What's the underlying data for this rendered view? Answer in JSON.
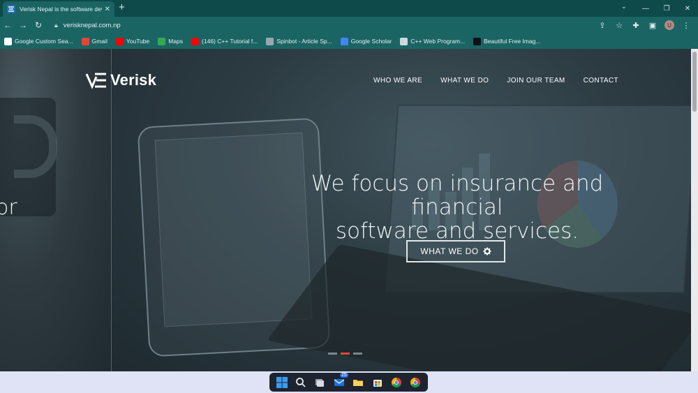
{
  "browser": {
    "tab_title": "Verisk Nepal is the software deve",
    "url": "verisknepal.com.np",
    "new_tab": "+",
    "tab_close": "✕"
  },
  "bookmarks": [
    {
      "label": "Google Custom Sea...",
      "icon": "google-icon",
      "color": "#ffffff"
    },
    {
      "label": "Gmail",
      "icon": "gmail-icon",
      "color": "#ea4335"
    },
    {
      "label": "YouTube",
      "icon": "youtube-icon",
      "color": "#ff0000"
    },
    {
      "label": "Maps",
      "icon": "maps-icon",
      "color": "#34a853"
    },
    {
      "label": "(146) C++ Tutorial f...",
      "icon": "youtube-icon",
      "color": "#ff0000"
    },
    {
      "label": "Spinbot - Article Sp...",
      "icon": "spinbot-icon",
      "color": "#9aa7b0"
    },
    {
      "label": "Google Scholar",
      "icon": "scholar-icon",
      "color": "#4285f4"
    },
    {
      "label": "C++ Web Program...",
      "icon": "web-icon",
      "color": "#cfd8dc"
    },
    {
      "label": "Beautiful Free Imag...",
      "icon": "unsplash-icon",
      "color": "#111111"
    }
  ],
  "profile_initial": "U",
  "site": {
    "logo_text": "Verisk",
    "nav": [
      "WHO WE ARE",
      "WHAT WE DO",
      "JOIN OUR TEAM",
      "CONTACT"
    ],
    "hero_line1": "We focus on insurance and financial",
    "hero_line2": "software and services.",
    "hero_button": "WHAT WE DO",
    "partial_left_text": "or",
    "slides": 3,
    "active_slide": 2,
    "accent_color": "#e0493a"
  },
  "taskbar": {
    "mail_badge": "25"
  }
}
